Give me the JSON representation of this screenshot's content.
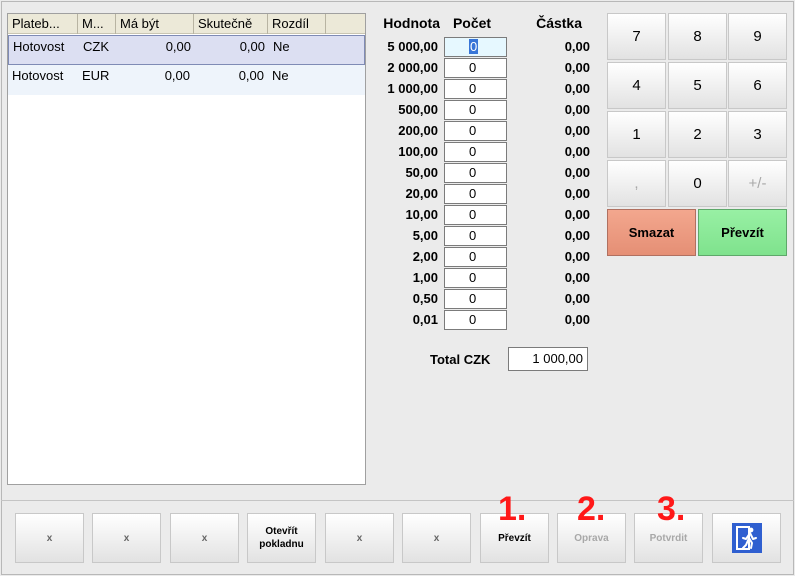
{
  "grid": {
    "headers": [
      "Plateb...",
      "M...",
      "Má být",
      "Skutečně",
      "Rozdíl"
    ],
    "rows": [
      [
        "Hotovost",
        "CZK",
        "0,00",
        "0,00",
        "Ne"
      ],
      [
        "Hotovost",
        "EUR",
        "0,00",
        "0,00",
        "Ne"
      ]
    ]
  },
  "denoms": {
    "header_value": "Hodnota",
    "header_count": "Počet",
    "header_amount": "Částka",
    "rows": [
      {
        "value": "5 000,00",
        "count": "0",
        "amount": "0,00"
      },
      {
        "value": "2 000,00",
        "count": "0",
        "amount": "0,00"
      },
      {
        "value": "1 000,00",
        "count": "0",
        "amount": "0,00"
      },
      {
        "value": "500,00",
        "count": "0",
        "amount": "0,00"
      },
      {
        "value": "200,00",
        "count": "0",
        "amount": "0,00"
      },
      {
        "value": "100,00",
        "count": "0",
        "amount": "0,00"
      },
      {
        "value": "50,00",
        "count": "0",
        "amount": "0,00"
      },
      {
        "value": "20,00",
        "count": "0",
        "amount": "0,00"
      },
      {
        "value": "10,00",
        "count": "0",
        "amount": "0,00"
      },
      {
        "value": "5,00",
        "count": "0",
        "amount": "0,00"
      },
      {
        "value": "2,00",
        "count": "0",
        "amount": "0,00"
      },
      {
        "value": "1,00",
        "count": "0",
        "amount": "0,00"
      },
      {
        "value": "0,50",
        "count": "0",
        "amount": "0,00"
      },
      {
        "value": "0,01",
        "count": "0",
        "amount": "0,00"
      }
    ],
    "total_label": "Total CZK",
    "total_value": "1 000,00"
  },
  "keypad": {
    "k7": "7",
    "k8": "8",
    "k9": "9",
    "k4": "4",
    "k5": "5",
    "k6": "6",
    "k1": "1",
    "k2": "2",
    "k3": "3",
    "comma": ",",
    "k0": "0",
    "sign": "+/-",
    "delete": "Smazat",
    "accept": "Převzít"
  },
  "bottom": {
    "b1": "x",
    "b2": "x",
    "b3": "x",
    "open_register": "Otevřít pokladnu",
    "b5": "x",
    "b6": "x",
    "accept": "Převzít",
    "correct": "Oprava",
    "confirm": "Potvrdit",
    "step1": "1.",
    "step2": "2.",
    "step3": "3."
  },
  "colors": {
    "delete_bg": "#e58f75",
    "accept_bg": "#7fe28d",
    "step_number": "#ff1818",
    "exit_icon": "#2f5fd0"
  }
}
